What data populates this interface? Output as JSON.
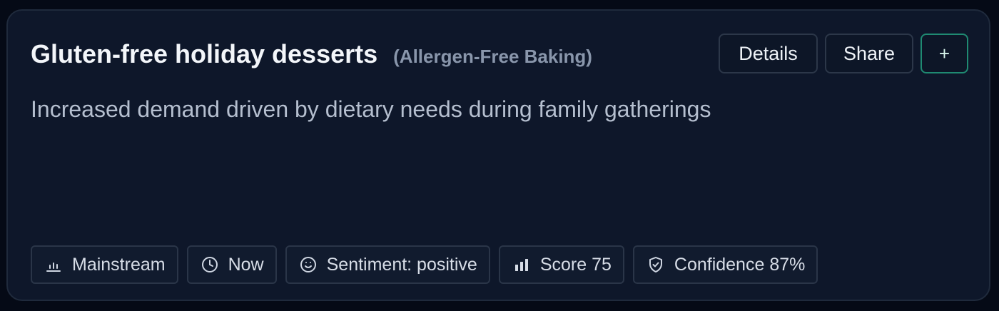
{
  "card": {
    "title": "Gluten-free holiday desserts",
    "category": "(Allergen-Free Baking)",
    "description": "Increased demand driven by dietary needs during family gatherings"
  },
  "actions": {
    "details_label": "Details",
    "share_label": "Share",
    "add_label": "+"
  },
  "tags": [
    {
      "label": "Mainstream",
      "icon": "bar-chart-low-icon"
    },
    {
      "label": "Now",
      "icon": "clock-icon"
    },
    {
      "label": "Sentiment: positive",
      "icon": "smile-icon"
    },
    {
      "label": "Score 75",
      "icon": "bar-chart-icon"
    },
    {
      "label": "Confidence 87%",
      "icon": "shield-check-icon"
    }
  ],
  "colors": {
    "background": "#050a16",
    "card": "#0e172a",
    "accent": "#1f8a72"
  }
}
